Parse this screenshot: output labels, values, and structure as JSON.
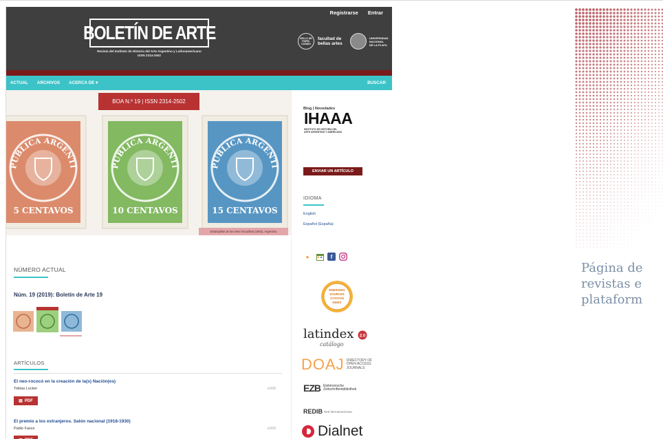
{
  "header": {
    "links": [
      "Registrarse",
      "Entrar"
    ],
    "logo_text": "BOLETÍN DE ARTE",
    "subtitle_line1": "Revista del Instituto de Historia del Arte Argentino y Latinoamericano",
    "subtitle_line2": "ISSN 2314-2502",
    "partner1_seal": "SELLO DE PAPEL COSIDO",
    "partner1_line1": "facultad de",
    "partner1_line2": "bellas artes",
    "partner2_line1": "UNIVERSIDAD",
    "partner2_line2": "NACIONAL",
    "partner2_line3": "DE LA PLATA"
  },
  "nav": {
    "items": [
      "ACTUAL",
      "ARCHIVOS",
      "ACERCA DE ▾"
    ],
    "search": "BUSCAR"
  },
  "hero": {
    "banner": "BOA N.º 19 | ISSN 2314-2502",
    "caption": "Estampillas de las serie Escuditos (1862), Argentina",
    "stamps": [
      {
        "line_top": "REPUBLICA ARGENTINA",
        "value": "5 CENTAVOS",
        "color": "#d77a57"
      },
      {
        "line_top": "REPUBLICA ARGENTINA",
        "value": "10 CENTAVOS",
        "color": "#6fb04a"
      },
      {
        "line_top": "REPUBLICA ARGENTINA",
        "value": "15 CENTAVOS",
        "color": "#3c87bd"
      }
    ]
  },
  "main": {
    "current_title": "NÚMERO ACTUAL",
    "issue": "Núm. 19 (2019): Boletín de Arte 19",
    "articles_title": "ARTÍCULOS",
    "pdf_label": "PDF",
    "articles": [
      {
        "title": "El neo-rococó en la creación de la(s) Nación(es)",
        "author": "Tobías Locker",
        "pages": "e008"
      },
      {
        "title": "El premio a los extranjeros. Salón nacional (1918-1930)",
        "author": "Pablo Fasce",
        "pages": "e009"
      }
    ]
  },
  "sidebar": {
    "blog_label": "Blog | Novedades",
    "ihaaa_big": "IHAAA",
    "ihaaa_small1": "INSTITUTO DE HISTORIA DEL",
    "ihaaa_small2": "ARTE ARGENTINO Y AMERICANO",
    "submit_button": "ENVIAR UN ARTÍCULO",
    "language_title": "IDIOMA",
    "languages": [
      "English",
      "Español (España)"
    ],
    "esci_lines": [
      "EMERGING",
      "SOURCES",
      "CITATION",
      "INDEX"
    ],
    "latindex": "latindex",
    "latindex_sub": "catálogo",
    "latindex_version": "2.0",
    "doaj_big": "DOAJ",
    "doaj_small": [
      "DIRECTORY OF",
      "OPEN ACCESS",
      "JOURNALS"
    ],
    "ezb_big": "EZB",
    "ezb_small": [
      "Elektronische",
      "Zeitschriftenbibliothek"
    ],
    "redib_big": "REDIB",
    "redib_small": "Red Iberoamericana",
    "dialnet": "Dialnet"
  },
  "right_caption": {
    "lines": [
      "Página de",
      "revistas e",
      "plataform"
    ],
    "color": "#7b8fa6"
  },
  "colors": {
    "header_bg": "#3f3f3f",
    "nav_bg": "#3cc3c8",
    "accent_red": "#b83232",
    "dark_red": "#7a1a1a",
    "link_blue": "#1f4b8f",
    "dot_red": "#b0474f"
  }
}
